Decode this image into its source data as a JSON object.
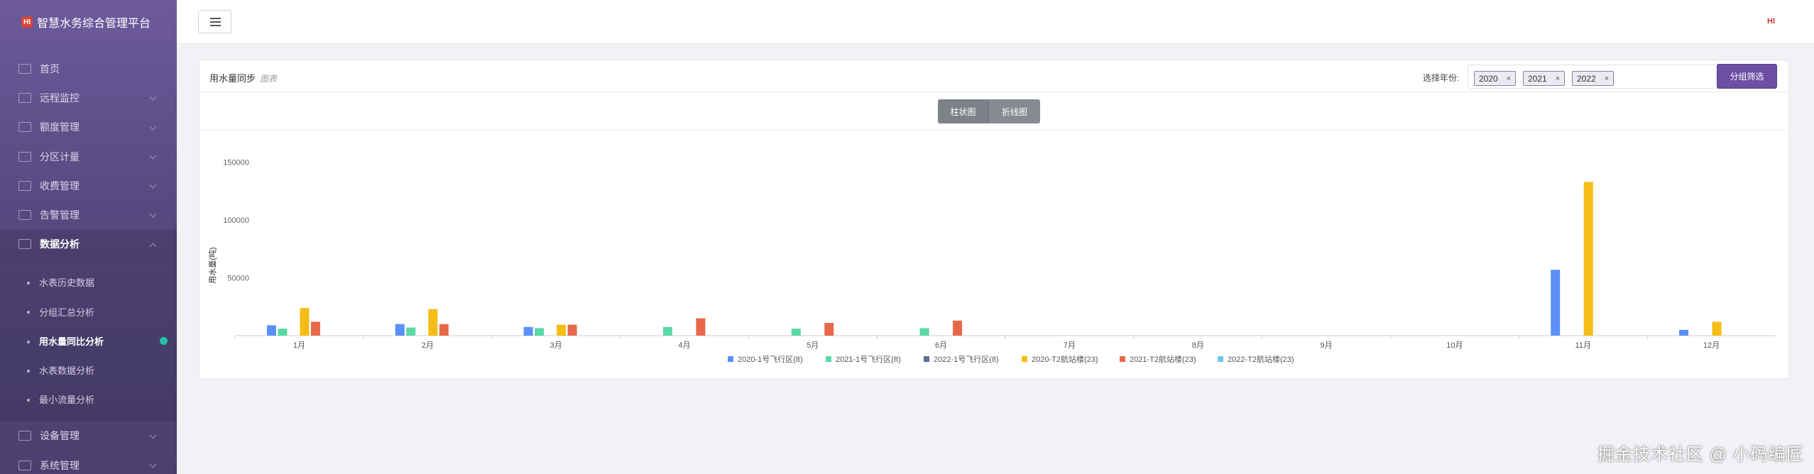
{
  "app": {
    "title": "智慧水务综合管理平台",
    "logo_text": "HI"
  },
  "sidebar": {
    "items": [
      {
        "label": "首页",
        "icon": "home-icon",
        "has_children": false
      },
      {
        "label": "远程监控",
        "icon": "monitor-icon",
        "has_children": true
      },
      {
        "label": "额度管理",
        "icon": "quota-icon",
        "has_children": true
      },
      {
        "label": "分区计量",
        "icon": "grid-icon",
        "has_children": true
      },
      {
        "label": "收费管理",
        "icon": "coin-icon",
        "has_children": true
      },
      {
        "label": "告警管理",
        "icon": "bell-icon",
        "has_children": true
      },
      {
        "label": "数据分析",
        "icon": "analytics-icon",
        "has_children": true,
        "active": true
      }
    ],
    "subitems": [
      {
        "label": "水表历史数据"
      },
      {
        "label": "分组汇总分析"
      },
      {
        "label": "用水量同比分析",
        "active": true
      },
      {
        "label": "水表数据分析"
      },
      {
        "label": "最小流量分析"
      }
    ],
    "items_after": [
      {
        "label": "设备管理",
        "icon": "device-icon"
      },
      {
        "label": "系统管理",
        "icon": "settings-icon"
      }
    ]
  },
  "header": {
    "menu_toggle_icon": "hamburger-icon",
    "right_logo": "HI"
  },
  "card": {
    "title": "用水量同步",
    "subtitle": "图表",
    "year_label": "选择年份:",
    "selected_years": [
      "2020",
      "2021",
      "2022"
    ],
    "remove_glyph": "×",
    "filter_button": "分组筛选",
    "view_buttons": [
      "柱状图",
      "折线图"
    ]
  },
  "chart_data": {
    "type": "bar",
    "ylabel": "用水量(吨)",
    "ylim": [
      0,
      150000
    ],
    "yticks": [
      "150000",
      "100000",
      "50000"
    ],
    "categories": [
      "1月",
      "2月",
      "3月",
      "4月",
      "5月",
      "6月",
      "7月",
      "8月",
      "9月",
      "10月",
      "11月",
      "12月"
    ],
    "series": [
      {
        "name": "2020-1号飞行区(8)",
        "color": "#5b8ff9",
        "values": [
          9000,
          10000,
          7500,
          0,
          0,
          0,
          0,
          0,
          0,
          0,
          57000,
          5000
        ]
      },
      {
        "name": "2021-1号飞行区(8)",
        "color": "#5ad8a6",
        "values": [
          6000,
          7000,
          6500,
          7500,
          6000,
          6500,
          0,
          0,
          0,
          0,
          0,
          0
        ]
      },
      {
        "name": "2022-1号飞行区(8)",
        "color": "#5d7092",
        "values": [
          0,
          0,
          0,
          0,
          0,
          0,
          0,
          0,
          0,
          0,
          0,
          0
        ]
      },
      {
        "name": "2020-T2航站楼(23)",
        "color": "#f6bd16",
        "values": [
          24000,
          23000,
          9500,
          0,
          0,
          0,
          0,
          0,
          0,
          0,
          133000,
          12000
        ]
      },
      {
        "name": "2021-T2航站楼(23)",
        "color": "#e8684a",
        "values": [
          12000,
          10000,
          9500,
          15000,
          11000,
          13000,
          0,
          0,
          0,
          0,
          0,
          0
        ]
      },
      {
        "name": "2022-T2航站楼(23)",
        "color": "#6dc8ec",
        "values": [
          0,
          0,
          0,
          0,
          0,
          0,
          0,
          0,
          0,
          0,
          0,
          0
        ]
      }
    ],
    "legend_position": "bottom",
    "grid": false
  },
  "watermark": "掘金技术社区 @ 小码编匠"
}
